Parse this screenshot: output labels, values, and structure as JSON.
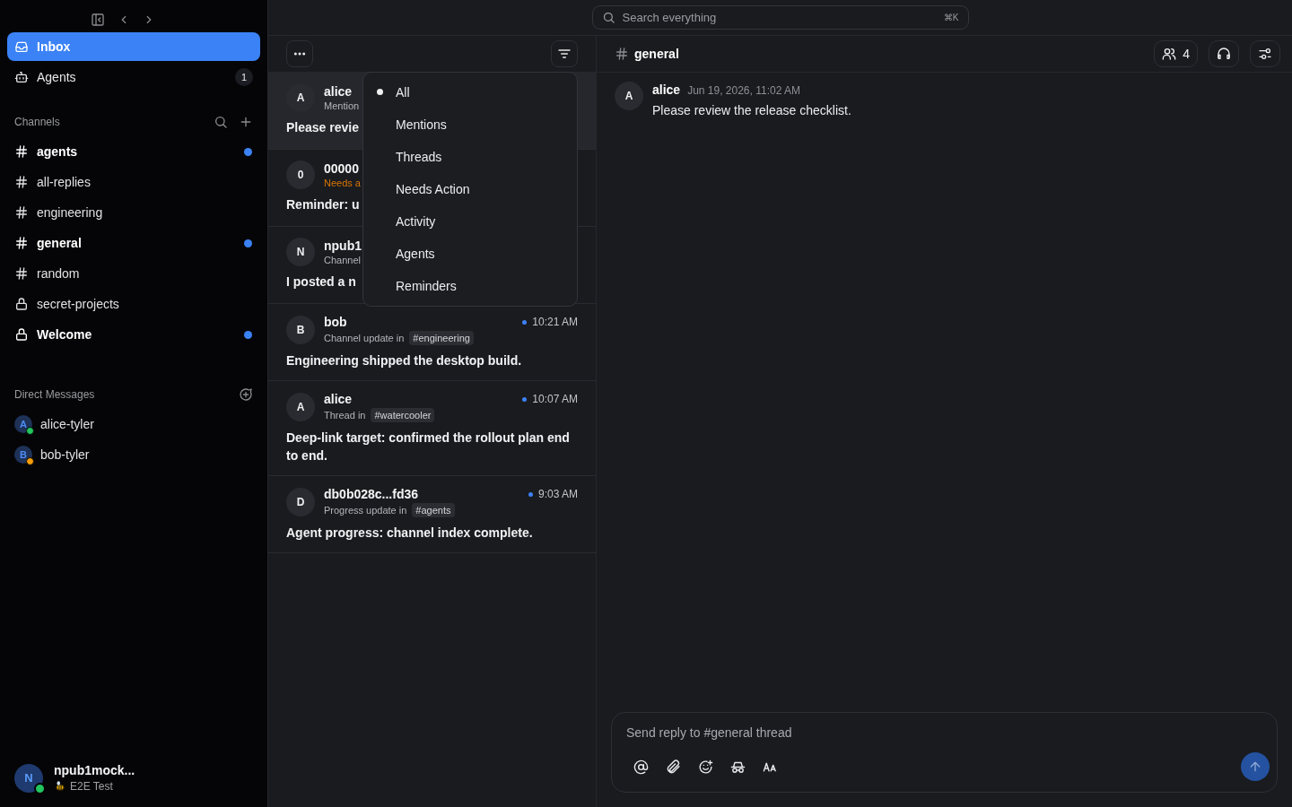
{
  "toolbar": {
    "search": {
      "placeholder": "Search everything",
      "shortcut": "⌘K"
    }
  },
  "sidebar": {
    "nav": [
      {
        "label": "Inbox",
        "selected": true
      },
      {
        "label": "Agents",
        "selected": false,
        "badge": "1"
      }
    ],
    "channels_heading": "Channels",
    "channels": [
      {
        "name": "agents",
        "kind": "public",
        "unread": true
      },
      {
        "name": "all-replies",
        "kind": "public",
        "unread": false
      },
      {
        "name": "engineering",
        "kind": "public",
        "unread": false
      },
      {
        "name": "general",
        "kind": "public",
        "unread": true
      },
      {
        "name": "random",
        "kind": "public",
        "unread": false
      },
      {
        "name": "secret-projects",
        "kind": "private",
        "unread": false
      },
      {
        "name": "Welcome",
        "kind": "private",
        "unread": true
      }
    ],
    "dm_heading": "Direct Messages",
    "direct_messages": [
      {
        "initial": "A",
        "name": "alice-tyler",
        "color": "#22c55e"
      },
      {
        "initial": "B",
        "name": "bob-tyler",
        "color": "#f59e0b"
      }
    ],
    "user": {
      "initial": "N",
      "name": "npub1mock...",
      "status": "E2E Test"
    }
  },
  "inbox": {
    "items": [
      {
        "initial": "A",
        "sender": "alice",
        "context": "Mention",
        "kind": "default",
        "preview": "Please revie",
        "selected": true
      },
      {
        "initial": "0",
        "sender": "00000",
        "context": "Needs a",
        "kind": "action",
        "preview": "Reminder: u",
        "selected": false
      },
      {
        "initial": "N",
        "sender": "npub1",
        "context": "Channel",
        "kind": "default",
        "preview": "I posted a n",
        "selected": false
      },
      {
        "initial": "B",
        "sender": "bob",
        "context": "Channel update in",
        "kind": "default",
        "channel": "#engineering",
        "time": "10:21 AM",
        "preview": "Engineering shipped the desktop build.",
        "selected": false,
        "unread": true
      },
      {
        "initial": "A",
        "sender": "alice",
        "context": "Thread in",
        "kind": "default",
        "channel": "#watercooler",
        "time": "10:07 AM",
        "preview": "Deep-link target: confirmed the rollout plan end to end.",
        "selected": false,
        "unread": true
      },
      {
        "initial": "D",
        "sender": "db0b028c...fd36",
        "context": "Progress update in",
        "kind": "default",
        "channel": "#agents",
        "time": "9:03 AM",
        "preview": "Agent progress: channel index complete.",
        "selected": false,
        "unread": true
      }
    ]
  },
  "filter_menu": {
    "options": [
      {
        "label": "All",
        "selected": true
      },
      {
        "label": "Mentions",
        "selected": false
      },
      {
        "label": "Threads",
        "selected": false
      },
      {
        "label": "Needs Action",
        "selected": false
      },
      {
        "label": "Activity",
        "selected": false
      },
      {
        "label": "Agents",
        "selected": false
      },
      {
        "label": "Reminders",
        "selected": false
      }
    ]
  },
  "channel_view": {
    "title": "general",
    "member_count": "4",
    "messages": [
      {
        "initial": "A",
        "author": "alice",
        "timestamp": "Jun 19, 2026, 11:02 AM",
        "text": "Please review the release checklist."
      }
    ]
  },
  "composer": {
    "placeholder": "Send reply to #general thread"
  }
}
